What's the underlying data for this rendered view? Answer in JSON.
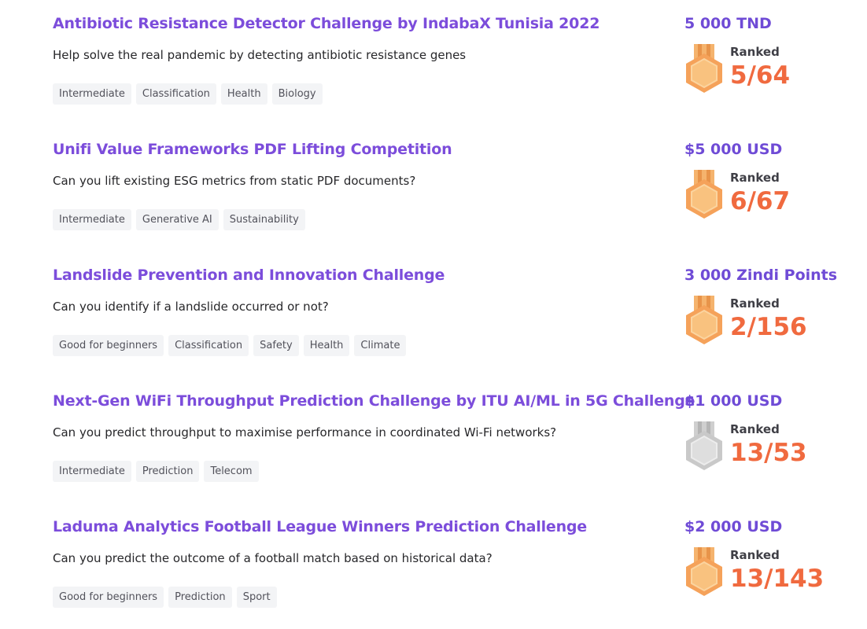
{
  "colors": {
    "title": "#7c4ddb",
    "prize": "#6f4bd6",
    "rank": "#f06a3f",
    "tag_bg": "#f3f4f6",
    "medal_bronze": "#f5a25a",
    "medal_silver": "#c9c9c9"
  },
  "competitions": [
    {
      "title": "Antibiotic Resistance Detector Challenge by IndabaX Tunisia 2022",
      "description": "Help solve the real pandemic by detecting antibiotic resistance genes",
      "tags": [
        "Intermediate",
        "Classification",
        "Health",
        "Biology"
      ],
      "prize": "5 000 TND",
      "ranked_label": "Ranked",
      "rank": "5/64",
      "medal": "bronze-medal-icon"
    },
    {
      "title": "Unifi Value Frameworks PDF Lifting Competition",
      "description": "Can you lift existing ESG metrics from static PDF documents?",
      "tags": [
        "Intermediate",
        "Generative AI",
        "Sustainability"
      ],
      "prize": "$5 000 USD",
      "ranked_label": "Ranked",
      "rank": "6/67",
      "medal": "bronze-medal-icon"
    },
    {
      "title": "Landslide Prevention and Innovation Challenge",
      "description": "Can you identify if a landslide occurred or not?",
      "tags": [
        "Good for beginners",
        "Classification",
        "Safety",
        "Health",
        "Climate"
      ],
      "prize": "3 000 Zindi Points",
      "ranked_label": "Ranked",
      "rank": "2/156",
      "medal": "bronze-medal-icon"
    },
    {
      "title": "Next-Gen WiFi Throughput Prediction Challenge by ITU AI/ML in 5G Challenge",
      "description": "Can you predict throughput to maximise performance in coordinated Wi-Fi networks?",
      "tags": [
        "Intermediate",
        "Prediction",
        "Telecom"
      ],
      "prize": "$1 000 USD",
      "ranked_label": "Ranked",
      "rank": "13/53",
      "medal": "silver-medal-icon"
    },
    {
      "title": "Laduma Analytics Football League Winners Prediction Challenge",
      "description": "Can you predict the outcome of a football match based on historical data?",
      "tags": [
        "Good for beginners",
        "Prediction",
        "Sport"
      ],
      "prize": "$2 000 USD",
      "ranked_label": "Ranked",
      "rank": "13/143",
      "medal": "bronze-medal-icon"
    }
  ]
}
